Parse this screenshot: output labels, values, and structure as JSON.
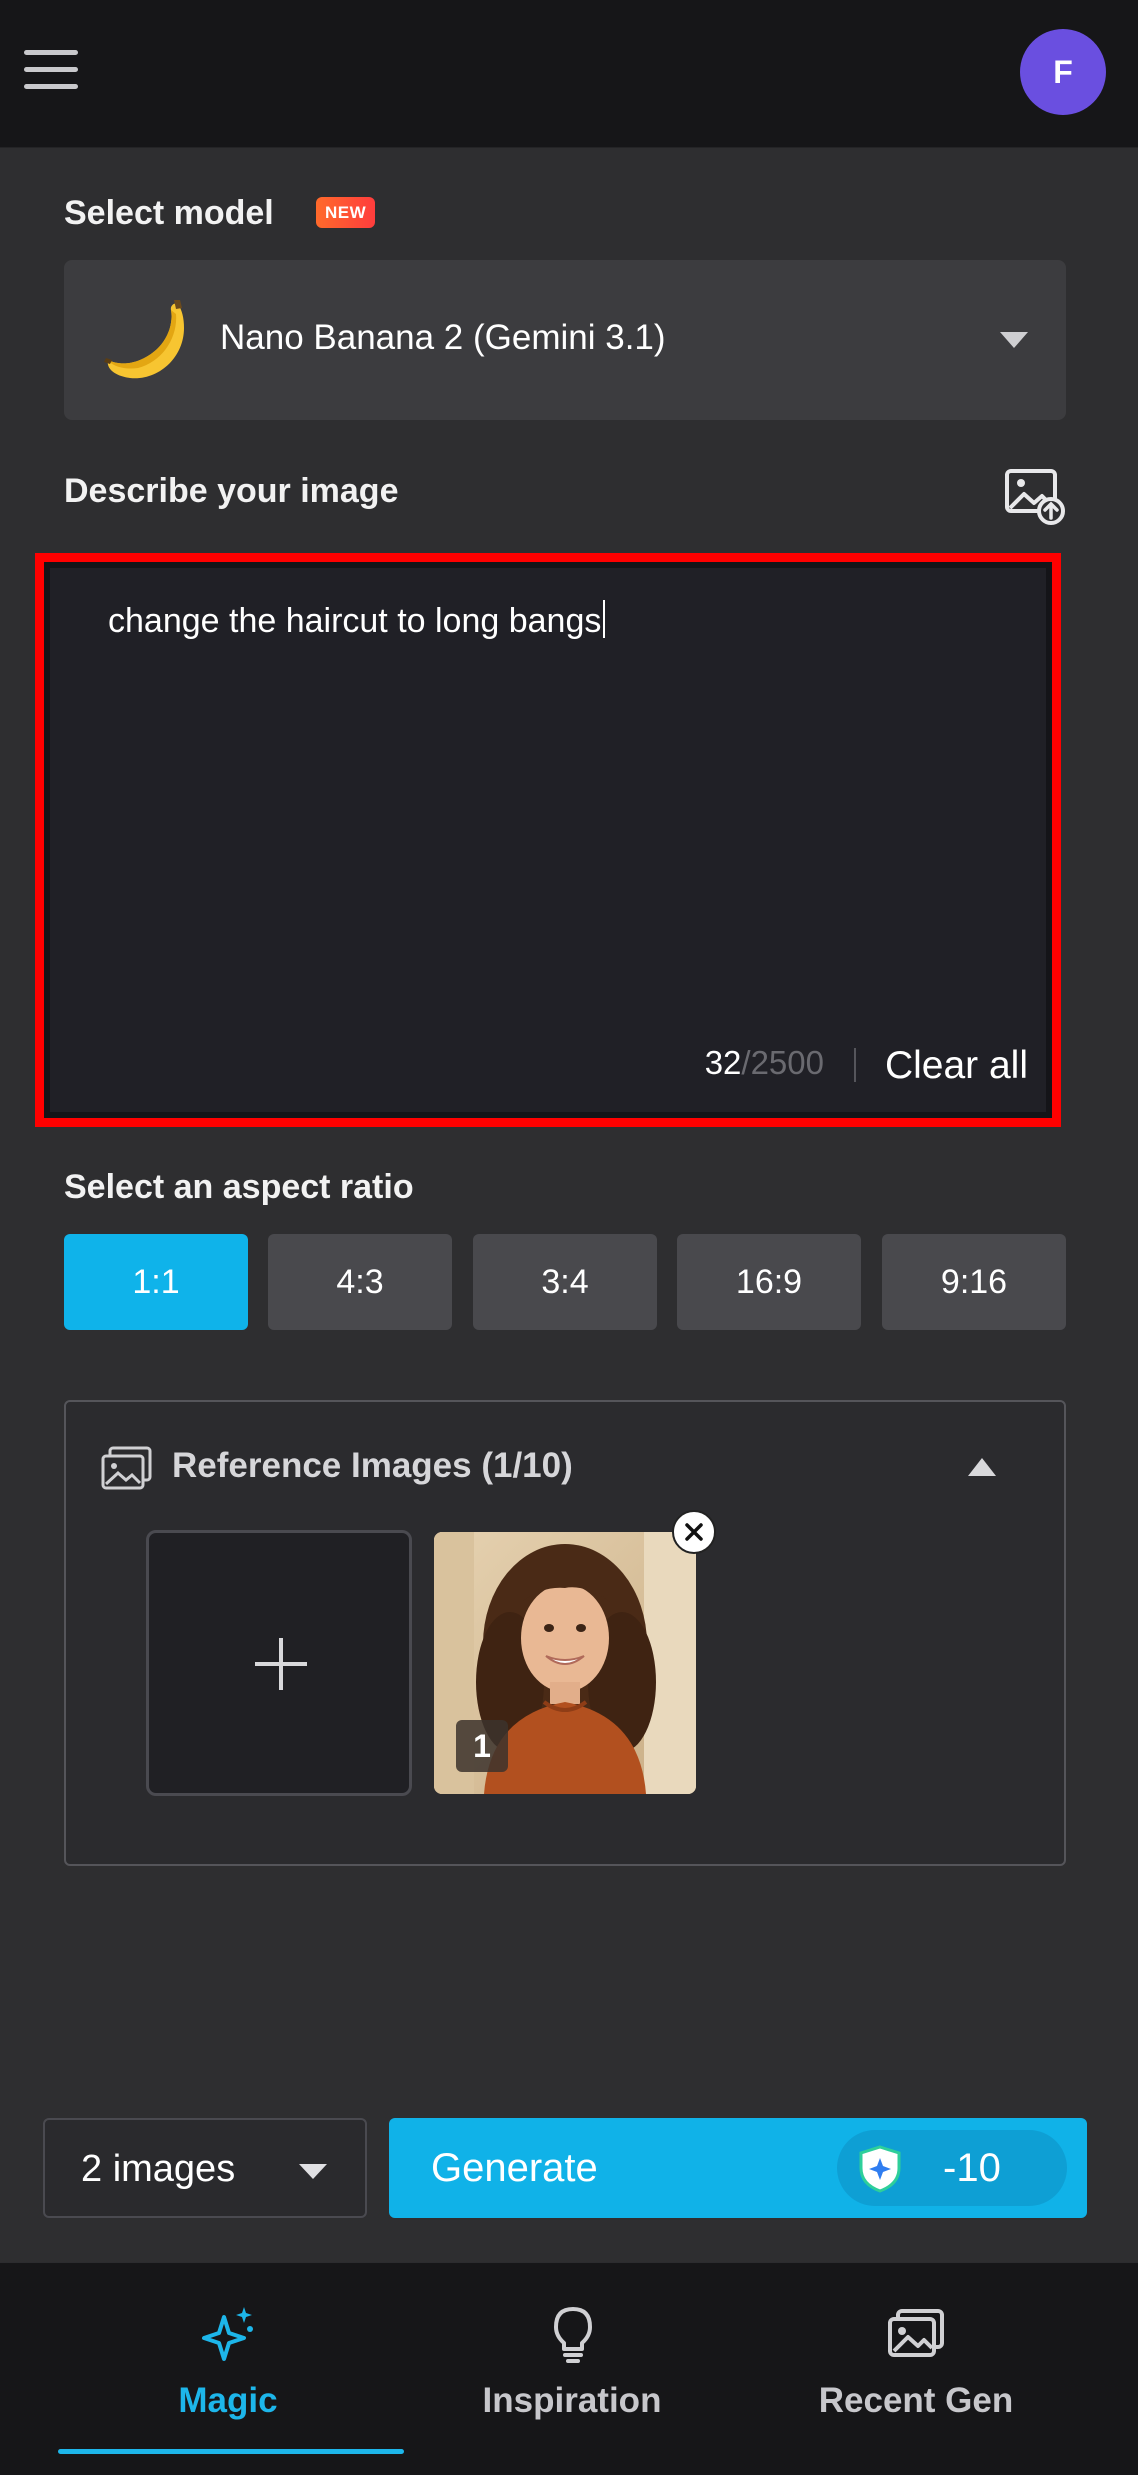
{
  "topbar": {
    "avatar_initial": "F"
  },
  "model": {
    "section_label": "Select model",
    "new_badge": "NEW",
    "selected": "Nano Banana 2 (Gemini 3.1)"
  },
  "prompt": {
    "section_label": "Describe your image",
    "value": "change the haircut to long bangs",
    "char_count": "32",
    "char_max": "/2500",
    "clear_label": "Clear all"
  },
  "aspect": {
    "section_label": "Select an aspect ratio",
    "options": [
      "1:1",
      "4:3",
      "3:4",
      "16:9",
      "9:16"
    ],
    "selected": "1:1"
  },
  "reference": {
    "title": "Reference Images (1/10)",
    "images": [
      {
        "index": "1"
      }
    ]
  },
  "actions": {
    "count_selected": "2 images",
    "generate_label": "Generate",
    "cost": "-10"
  },
  "nav": {
    "items": [
      {
        "label": "Magic",
        "icon": "sparkle-icon",
        "active": true
      },
      {
        "label": "Inspiration",
        "icon": "lightbulb-icon",
        "active": false
      },
      {
        "label": "Recent Gen",
        "icon": "gallery-icon",
        "active": false
      }
    ]
  },
  "colors": {
    "accent": "#0fb3ea",
    "highlight_border": "#ff0000",
    "avatar": "#6a4fe0"
  }
}
